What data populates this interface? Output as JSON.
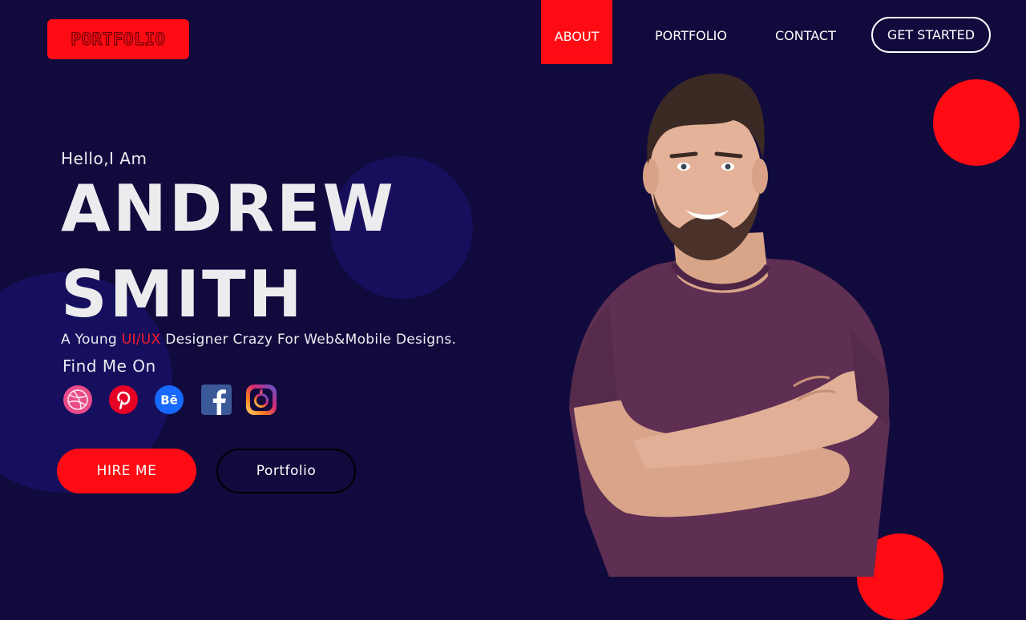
{
  "header": {
    "logo_text": "PORTFOLIO",
    "nav": [
      {
        "label": "ABOUT",
        "active": true
      },
      {
        "label": "PORTFOLIO",
        "active": false
      },
      {
        "label": "CONTACT",
        "active": false
      }
    ],
    "cta_label": "GET STARTED"
  },
  "hero": {
    "greeting": "Hello,I Am",
    "name_line1": "ANDREW",
    "name_line2": "SMITH",
    "tagline_prefix": "A Young ",
    "tagline_highlight": "UI/UX",
    "tagline_suffix": " Designer Crazy For Web&Mobile Designs.",
    "find_me": "Find Me On",
    "social_icons": [
      "dribbble-icon",
      "pinterest-icon",
      "behance-icon",
      "facebook-icon",
      "instagram-icon"
    ],
    "primary_button": "HIRE ME",
    "secondary_button": "Portfolio"
  },
  "colors": {
    "background": "#110a3d",
    "accent": "#ff0b13",
    "navy_circle": "#170f5c",
    "text": "#ececef"
  }
}
